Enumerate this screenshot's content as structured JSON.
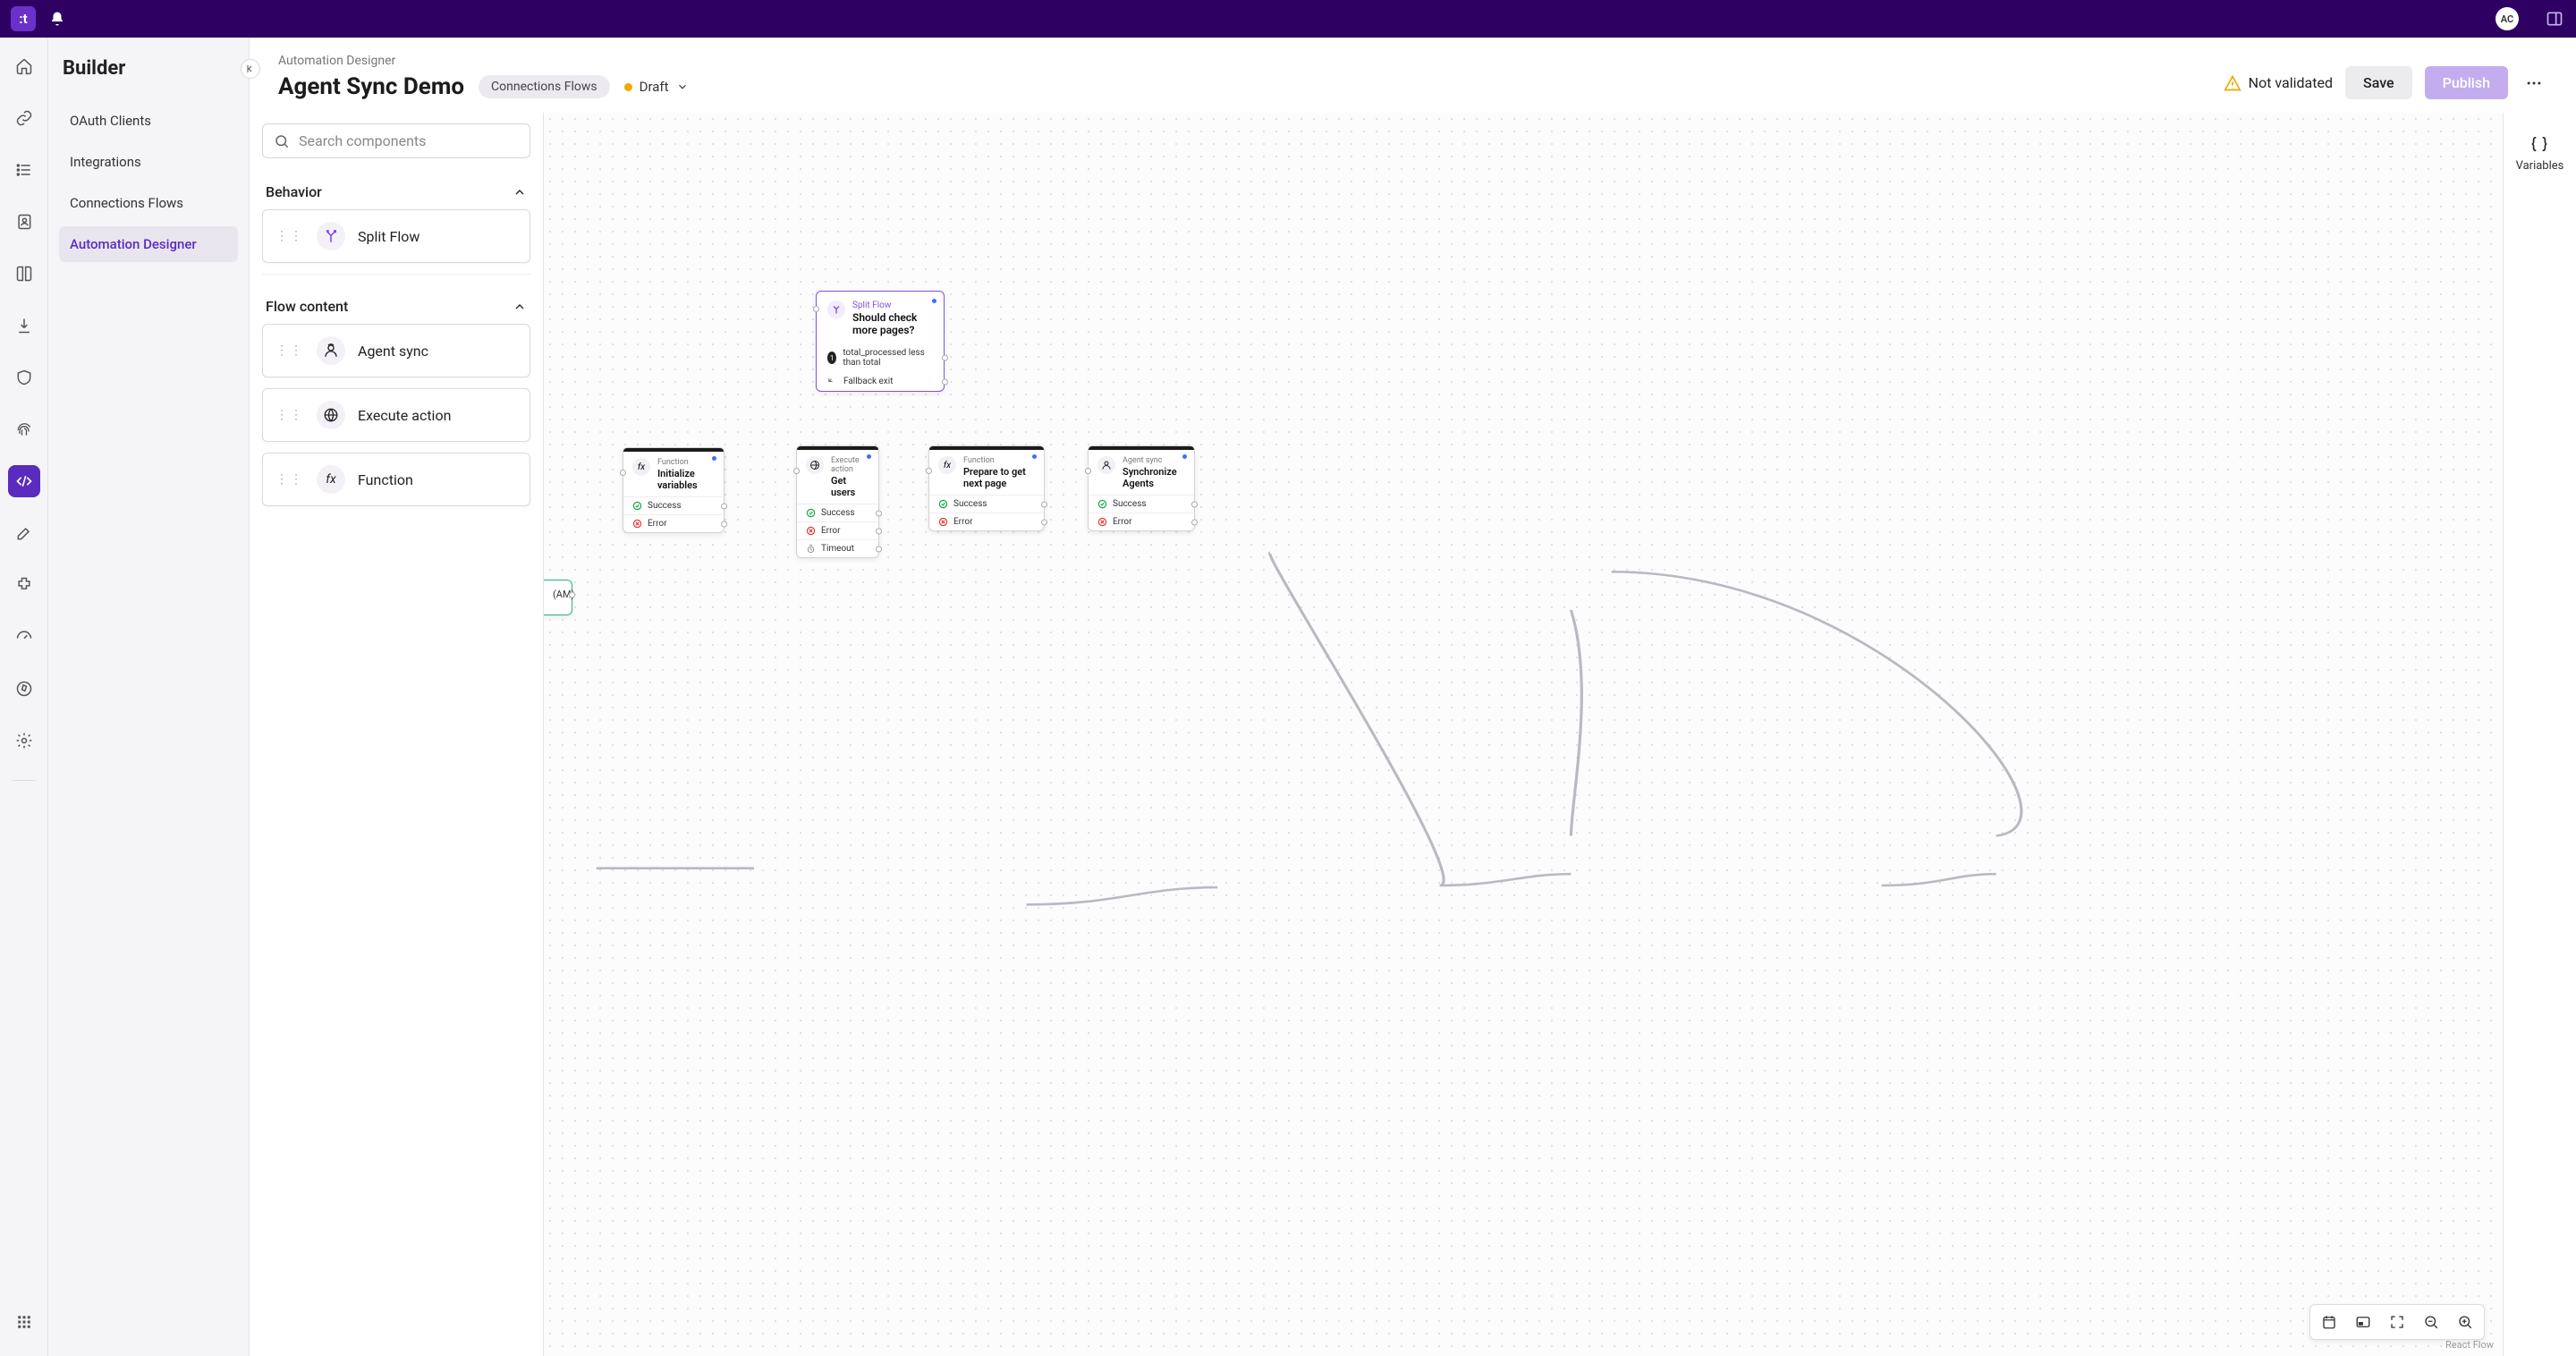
{
  "topbar": {
    "logo_text": ":t",
    "avatar_initials": "AC"
  },
  "rail": {
    "items": [
      "home",
      "link",
      "list",
      "contacts",
      "book",
      "import",
      "shield",
      "fingerprint",
      "code",
      "edit",
      "integration",
      "gauge",
      "compass",
      "settings"
    ],
    "active_index": 8
  },
  "secondary": {
    "title": "Builder",
    "items": [
      "OAuth Clients",
      "Integrations",
      "Connections Flows",
      "Automation Designer"
    ],
    "selected_index": 3
  },
  "header": {
    "breadcrumb": "Automation Designer",
    "title": "Agent Sync Demo",
    "chip": "Connections Flows",
    "status_label": "Draft",
    "not_validated": "Not validated",
    "save": "Save",
    "publish": "Publish"
  },
  "palette": {
    "search_placeholder": "Search components",
    "sections": [
      {
        "title": "Behavior",
        "items": [
          {
            "label": "Split Flow",
            "icon": "split"
          }
        ]
      },
      {
        "title": "Flow content",
        "items": [
          {
            "label": "Agent sync",
            "icon": "agent"
          },
          {
            "label": "Execute action",
            "icon": "globe"
          },
          {
            "label": "Function",
            "icon": "fx"
          }
        ]
      }
    ]
  },
  "right_rail": {
    "variables": "Variables"
  },
  "canvas": {
    "attribution": "React Flow",
    "entry": {
      "label": "(AM)"
    },
    "split": {
      "type": "Split Flow",
      "title": "Should check more pages?",
      "condition": "total_processed less than total",
      "fallback": "Fallback exit"
    },
    "nodes": [
      {
        "type": "Function",
        "title": "Initialize variables",
        "outs": [
          "Success",
          "Error"
        ]
      },
      {
        "type": "Execute action",
        "title": "Get users",
        "outs": [
          "Success",
          "Error",
          "Timeout"
        ]
      },
      {
        "type": "Function",
        "title": "Prepare to get next page",
        "outs": [
          "Success",
          "Error"
        ]
      },
      {
        "type": "Agent sync",
        "title": "Synchronize Agents",
        "outs": [
          "Success",
          "Error"
        ]
      }
    ]
  }
}
